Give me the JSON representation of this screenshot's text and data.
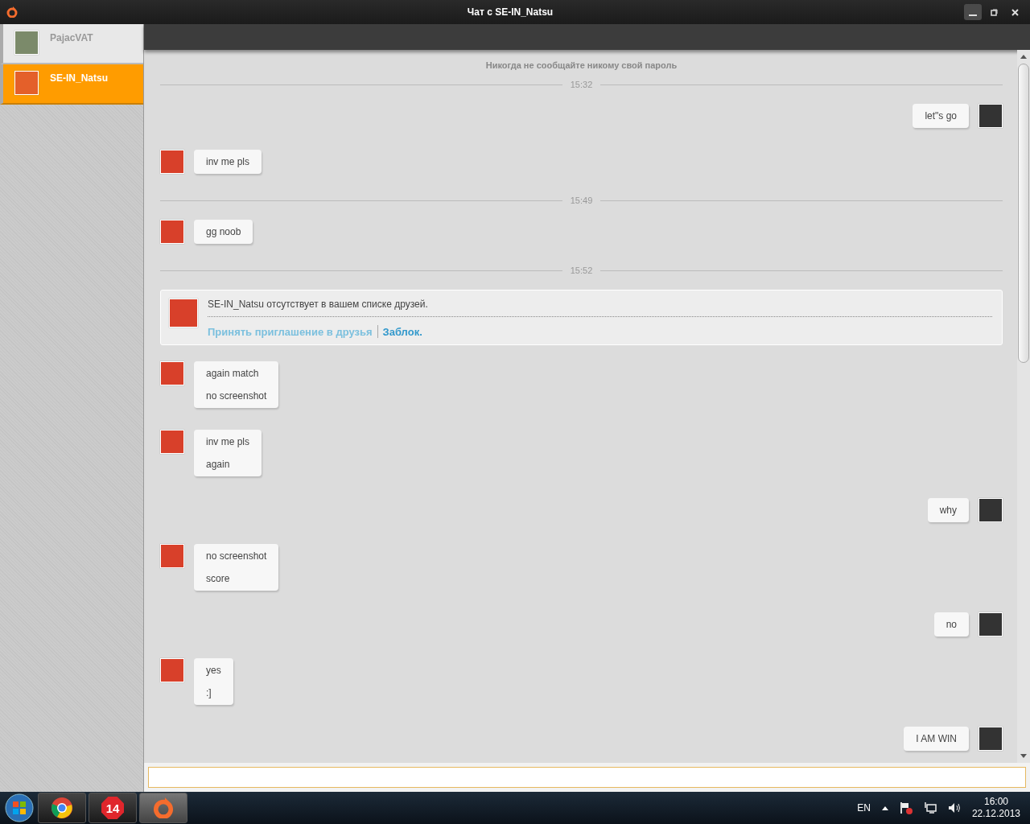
{
  "window": {
    "title": "Чат с SE-IN_Natsu"
  },
  "contacts": [
    {
      "name": "PajacVAT",
      "selected": false
    },
    {
      "name": "SE-IN_Natsu",
      "selected": true
    }
  ],
  "messages": [
    {
      "kind": "notice",
      "text": "Никогда не сообщайте никому свой пароль"
    },
    {
      "kind": "time",
      "text": "15:32"
    },
    {
      "kind": "outgoing",
      "lines": [
        "let\"s go"
      ]
    },
    {
      "kind": "incoming",
      "lines": [
        "inv me pls"
      ]
    },
    {
      "kind": "time",
      "text": "15:49"
    },
    {
      "kind": "incoming",
      "lines": [
        "gg noob"
      ]
    },
    {
      "kind": "time",
      "text": "15:52"
    },
    {
      "kind": "request",
      "text": "SE-IN_Natsu отсутствует в вашем списке друзей.",
      "accept": "Принять приглашение в друзья",
      "block": "Заблок."
    },
    {
      "kind": "incoming",
      "lines": [
        "again match",
        "no screenshot"
      ]
    },
    {
      "kind": "incoming",
      "lines": [
        "inv me pls",
        "again"
      ]
    },
    {
      "kind": "outgoing",
      "lines": [
        "why"
      ]
    },
    {
      "kind": "incoming",
      "lines": [
        "no screenshot",
        "score"
      ]
    },
    {
      "kind": "outgoing",
      "lines": [
        "no"
      ]
    },
    {
      "kind": "incoming",
      "lines": [
        "yes",
        ":]"
      ]
    },
    {
      "kind": "outgoing",
      "lines": [
        "I AM WIN"
      ]
    }
  ],
  "taskbar": {
    "apps": [
      {
        "kind": "chrome",
        "selected": false
      },
      {
        "kind": "badge",
        "label": "14",
        "selected": false
      },
      {
        "kind": "origin",
        "selected": true
      }
    ],
    "language": "EN",
    "time": "16:00",
    "date": "22.12.2013"
  }
}
